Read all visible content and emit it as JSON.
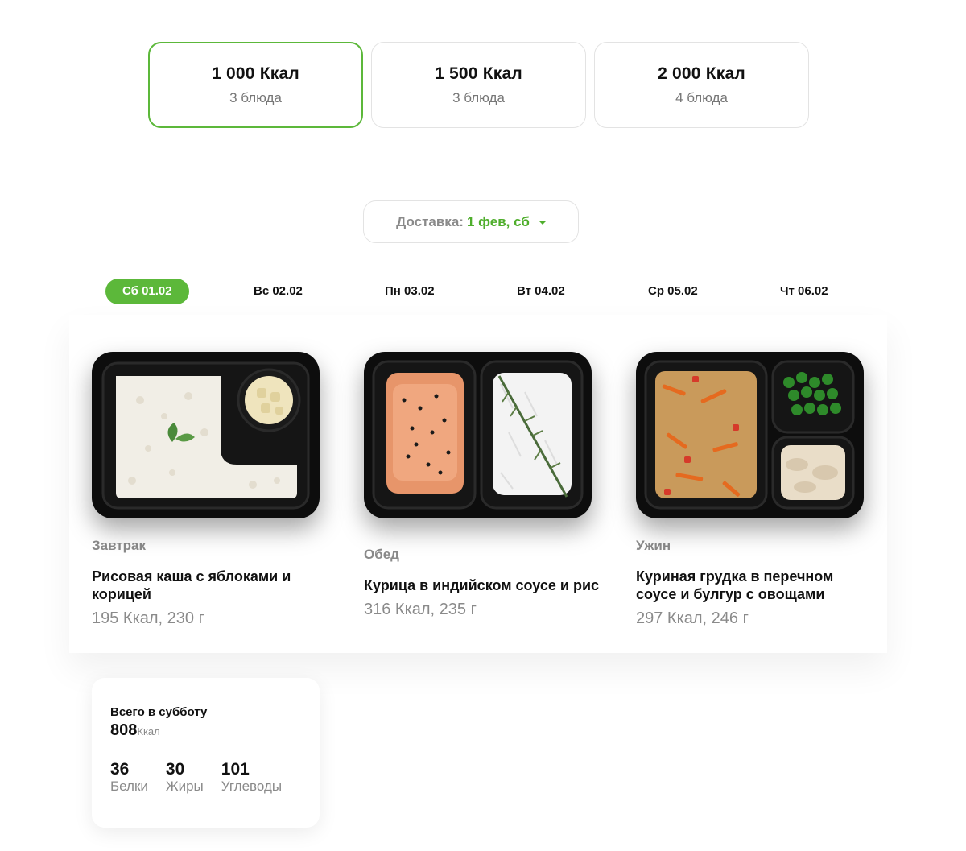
{
  "plans": [
    {
      "kcal": "1 000 Ккал",
      "dishes": "3 блюда",
      "active": true
    },
    {
      "kcal": "1 500 Ккал",
      "dishes": "3 блюда",
      "active": false
    },
    {
      "kcal": "2 000 Ккал",
      "dishes": "4 блюда",
      "active": false
    }
  ],
  "delivery": {
    "label": "Доставка:",
    "value": "1 фев, сб"
  },
  "days": [
    {
      "label": "Сб 01.02",
      "active": true
    },
    {
      "label": "Вс 02.02",
      "active": false
    },
    {
      "label": "Пн 03.02",
      "active": false
    },
    {
      "label": "Вт 04.02",
      "active": false
    },
    {
      "label": "Ср 05.02",
      "active": false
    },
    {
      "label": "Чт 06.02",
      "active": false
    }
  ],
  "meals": [
    {
      "type": "Завтрак",
      "name": "Рисовая каша с яблоками и корицей",
      "info": "195 Ккал, 230 г"
    },
    {
      "type": "Обед",
      "name": "Курица в индийском соусе и рис",
      "info": "316 Ккал, 235 г"
    },
    {
      "type": "Ужин",
      "name": "Куриная грудка в перечном соусе и булгур с овощами",
      "info": "297 Ккал, 246 г"
    }
  ],
  "summary": {
    "title": "Всего в субботу",
    "total": "808",
    "unit": "Ккал",
    "macros": [
      {
        "value": "36",
        "label": "Белки"
      },
      {
        "value": "30",
        "label": "Жиры"
      },
      {
        "value": "101",
        "label": "Углеводы"
      }
    ]
  },
  "colors": {
    "accent": "#5cb83a",
    "muted": "#8a8a8a"
  }
}
